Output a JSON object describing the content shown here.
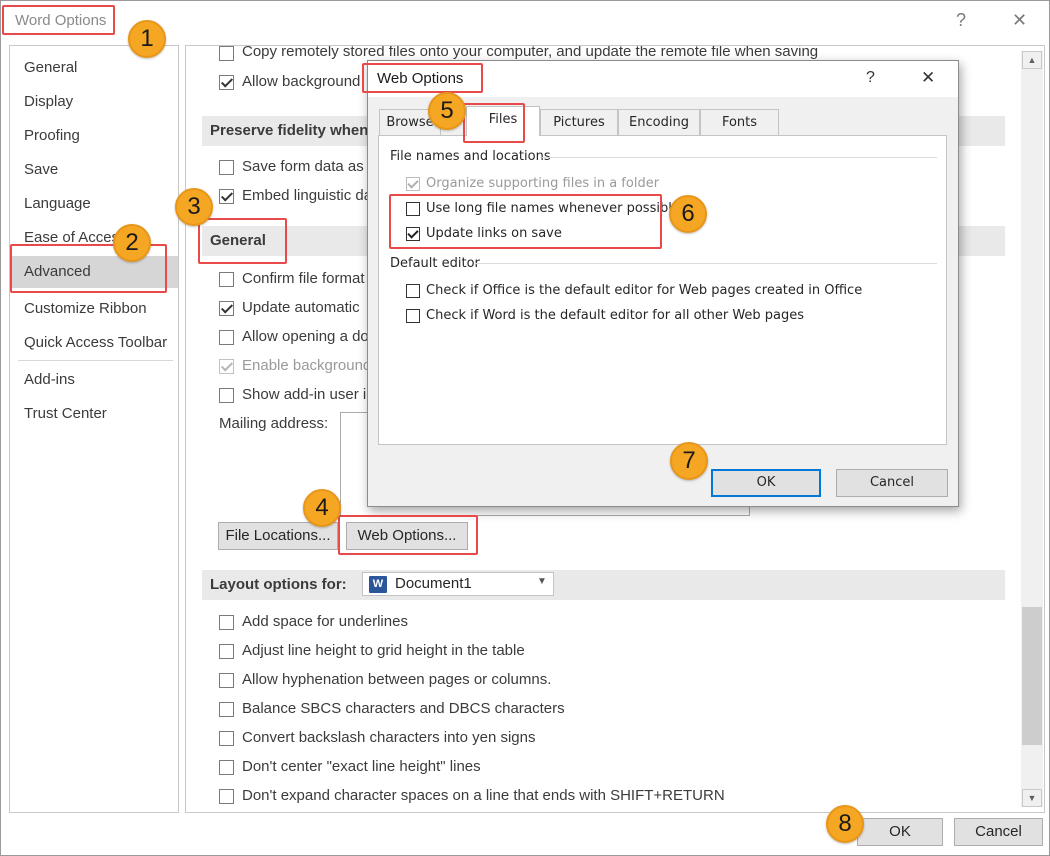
{
  "window": {
    "title": "Word Options",
    "help": "?",
    "close": "✕"
  },
  "sidebar": {
    "items": [
      {
        "label": "General"
      },
      {
        "label": "Display"
      },
      {
        "label": "Proofing"
      },
      {
        "label": "Save"
      },
      {
        "label": "Language"
      },
      {
        "label": "Ease of Access"
      },
      {
        "label": "Advanced",
        "active": true
      },
      {
        "label": "Customize Ribbon"
      },
      {
        "label": "Quick Access Toolbar"
      },
      {
        "label": "Add-ins"
      },
      {
        "label": "Trust Center"
      }
    ]
  },
  "main": {
    "top_options": [
      {
        "label": "Copy remotely stored files onto your computer, and update the remote file when saving",
        "checked": false
      },
      {
        "label": "Allow background",
        "checked": true
      }
    ],
    "preserve_section": "Preserve fidelity when",
    "preserve_options": [
      {
        "label": "Save form data as",
        "checked": false
      },
      {
        "label": "Embed linguistic da",
        "checked": true
      }
    ],
    "general_section": "General",
    "general_options": [
      {
        "label": "Confirm file format",
        "checked": false,
        "disabled": false
      },
      {
        "label": "Update automatic",
        "checked": true,
        "disabled": false
      },
      {
        "label": "Allow opening a do",
        "checked": false,
        "disabled": false
      },
      {
        "label": "Enable background",
        "checked": true,
        "disabled": true
      },
      {
        "label": "Show add-in user in",
        "checked": false,
        "disabled": false
      }
    ],
    "mailing_label": "Mailing address:",
    "file_locations_button": "File Locations...",
    "web_options_button": "Web Options...",
    "layout_section": "Layout options for:",
    "layout_document": "Document1",
    "layout_options": [
      {
        "label": "Add space for underlines",
        "checked": false
      },
      {
        "label": "Adjust line height to grid height in the table",
        "checked": false
      },
      {
        "label": "Allow hyphenation between pages or columns.",
        "checked": false
      },
      {
        "label": "Balance SBCS characters and DBCS characters",
        "checked": false
      },
      {
        "label": "Convert backslash characters into yen signs",
        "checked": false
      },
      {
        "label": "Don't center \"exact line height\" lines",
        "checked": false
      },
      {
        "label": "Don't expand character spaces on a line that ends with SHIFT+RETURN",
        "checked": false
      }
    ],
    "ok_button": "OK",
    "cancel_button": "Cancel"
  },
  "web_options": {
    "title": "Web Options",
    "help": "?",
    "close": "✕",
    "tabs": [
      {
        "label": "Browse"
      },
      {
        "label": "Files",
        "active": true
      },
      {
        "label": "Pictures"
      },
      {
        "label": "Encoding"
      },
      {
        "label": "Fonts"
      }
    ],
    "group1_title": "File names and locations",
    "group1_options": [
      {
        "label": "Organize supporting files in a folder",
        "checked": true,
        "disabled": true
      },
      {
        "label": "Use long file names whenever possible",
        "checked": false,
        "disabled": false
      },
      {
        "label": "Update links on save",
        "checked": true,
        "disabled": false
      }
    ],
    "group2_title": "Default editor",
    "group2_options": [
      {
        "label": "Check if Office is the default editor for Web pages created in Office",
        "checked": false
      },
      {
        "label": "Check if Word is the default editor for all other Web pages",
        "checked": false
      }
    ],
    "ok_button": "OK",
    "cancel_button": "Cancel"
  },
  "annotations": {
    "steps": [
      "1",
      "2",
      "3",
      "4",
      "5",
      "6",
      "7",
      "8"
    ],
    "highlight_color": "#e84a4a",
    "badge_color": "#f5a623"
  }
}
